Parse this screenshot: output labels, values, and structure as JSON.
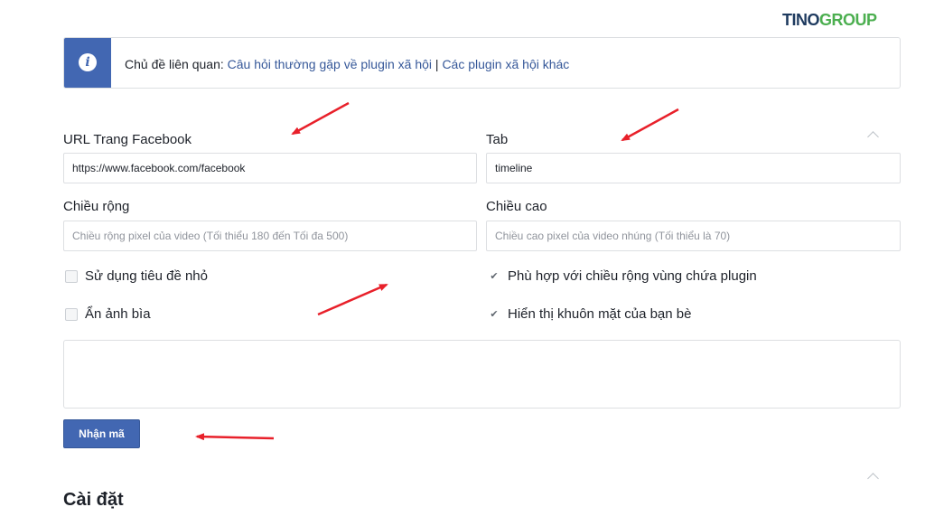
{
  "brand": {
    "part1": "TINO",
    "part2": "GR",
    "part3": "UP"
  },
  "info": {
    "prefix": "Chủ đề liên quan: ",
    "link1": "Câu hỏi thường gặp về plugin xã hội",
    "separator": " | ",
    "link2": "Các plugin xã hội khác"
  },
  "form": {
    "url_label": "URL Trang Facebook",
    "url_value": "https://www.facebook.com/facebook",
    "tab_label": "Tab",
    "tab_value": "timeline",
    "width_label": "Chiều rộng",
    "width_placeholder": "Chiều rộng pixel của video (Tối thiểu 180 đến Tối đa 500)",
    "height_label": "Chiều cao",
    "height_placeholder": "Chiều cao pixel của video nhúng (Tối thiểu là 70)",
    "checkboxes": [
      {
        "label": "Sử dụng tiêu đề nhỏ",
        "checked": false
      },
      {
        "label": "Ẩn ảnh bìa",
        "checked": false
      },
      {
        "label": "Phù hợp với chiều rộng vùng chứa plugin",
        "checked": true
      },
      {
        "label": "Hiển thị khuôn mặt của bạn bè",
        "checked": true
      }
    ],
    "get_code_button": "Nhận mã"
  },
  "settings": {
    "title": "Cài đặt"
  },
  "colors": {
    "accent": "#4267b2",
    "link": "#365899",
    "annotation": "#e8202a",
    "brand_green": "#4caf50"
  },
  "icons": {
    "info": "info-icon",
    "check": "check-icon",
    "chevron": "chevron-up-icon"
  }
}
